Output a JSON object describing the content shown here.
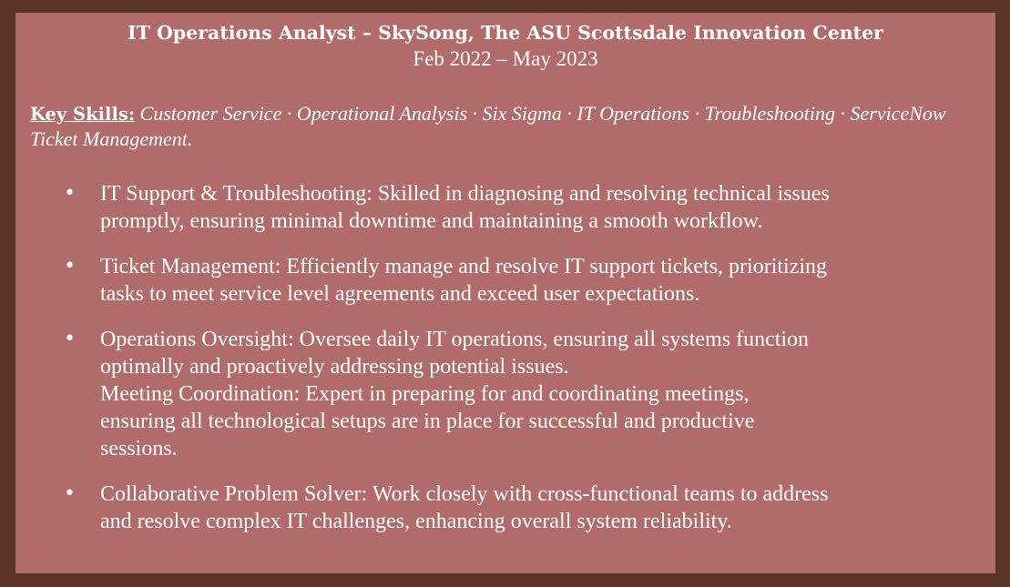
{
  "header": {
    "title": "IT Operations Analyst – SkySong, The ASU Scottsdale Innovation Center",
    "dates": "Feb 2022 – May 2023"
  },
  "skills": {
    "label": "Key Skills:",
    "list": " Customer Service · Operational Analysis · Six Sigma · IT Operations · Troubleshooting · ServiceNow Ticket Management."
  },
  "bullets": [
    {
      "lines": [
        "IT Support & Troubleshooting: Skilled in diagnosing and resolving technical issues",
        "promptly, ensuring minimal downtime and maintaining a smooth workflow."
      ]
    },
    {
      "lines": [
        "Ticket Management: Efficiently manage and resolve IT support tickets, prioritizing",
        "tasks to meet service level agreements and exceed user expectations."
      ]
    },
    {
      "lines": [
        "Operations Oversight: Oversee daily IT operations, ensuring all systems function",
        "optimally and proactively addressing potential issues.",
        "Meeting Coordination: Expert in preparing for and coordinating meetings,",
        "ensuring all technological setups are in place for successful and productive",
        "sessions."
      ]
    },
    {
      "lines": [
        "Collaborative Problem Solver: Work closely with cross-functional teams to address",
        "and resolve complex IT challenges, enhancing overall system reliability."
      ]
    }
  ]
}
